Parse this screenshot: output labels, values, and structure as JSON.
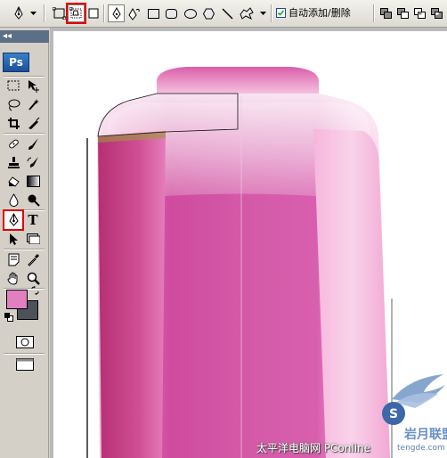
{
  "options_bar": {
    "auto_add_delete_label": "自动添加/删除",
    "auto_add_delete_checked": true,
    "pen_mode_selected": "paths"
  },
  "toolbox": {
    "header_glyph": "◂◂",
    "logo_text": "Ps",
    "type_tool_glyph": "T",
    "active_tool": "pen-tool",
    "foreground_color": "#e080c0",
    "background_color": "#4b525a"
  },
  "canvas": {
    "subject": "pink bottle",
    "colors": {
      "body": "#d55aa8",
      "highlight": "#f4b4d9",
      "shadow": "#b8306f"
    }
  },
  "watermark": {
    "text": "太平洋电脑网 PConline",
    "logo_text": "S",
    "site_text": "tengde.com"
  }
}
